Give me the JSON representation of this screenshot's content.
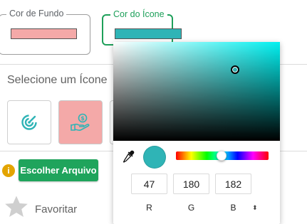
{
  "fields": {
    "background_color": {
      "label": "Cor de Fundo",
      "value": "#f4a9a8"
    },
    "icon_color": {
      "label": "Cor do Ícone",
      "value": "#2fb4b6"
    }
  },
  "icons_section": {
    "title": "Selecione um Ícone",
    "tiles": [
      {
        "icon": "radar-icon",
        "color": "#2fb4b6",
        "background": "#ffffff"
      },
      {
        "icon": "hand-money-icon",
        "color": "#2fb4b6",
        "background": "#f4a9a8"
      }
    ]
  },
  "upload": {
    "button_label": "Escolher Arquivo",
    "info_glyph": "i"
  },
  "favorite": {
    "label": "Favoritar"
  },
  "color_picker": {
    "hue_color": "#00f0f0",
    "hue_fraction": 0.49,
    "preview_color": "#2fb4b6",
    "channels": [
      {
        "label": "R",
        "value": "47"
      },
      {
        "label": "G",
        "value": "180"
      },
      {
        "label": "B",
        "value": "182"
      }
    ],
    "mode_toggle": "⬍"
  }
}
